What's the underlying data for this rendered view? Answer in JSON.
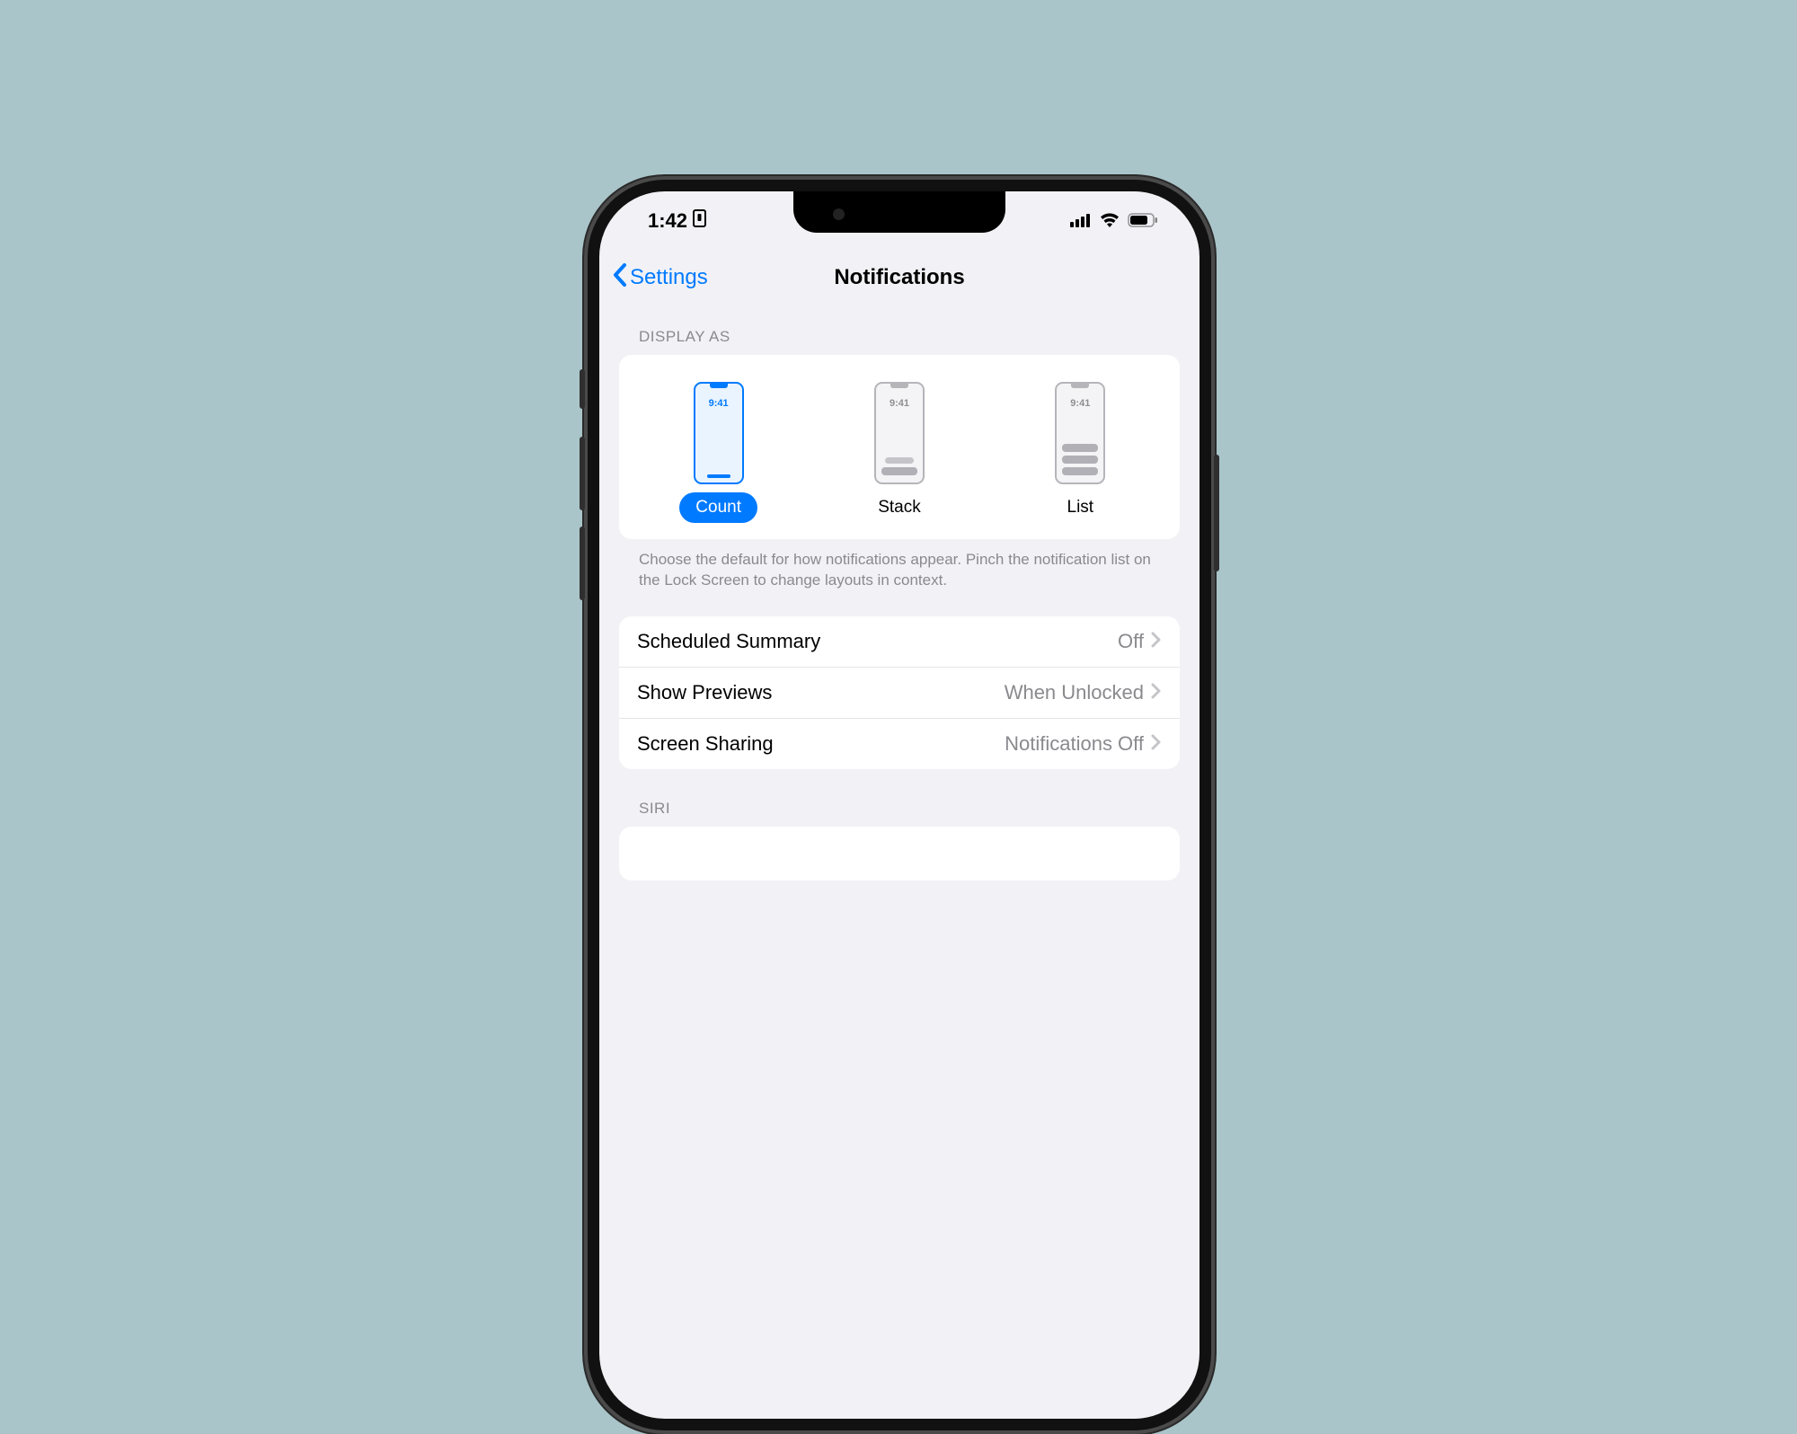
{
  "status": {
    "time": "1:42"
  },
  "nav": {
    "back": "Settings",
    "title": "Notifications"
  },
  "displayAs": {
    "header": "DISPLAY AS",
    "miniTime": "9:41",
    "options": {
      "count": "Count",
      "stack": "Stack",
      "list": "List"
    },
    "footer": "Choose the default for how notifications appear. Pinch the notification list on the Lock Screen to change layouts in context."
  },
  "rows": {
    "scheduled": {
      "label": "Scheduled Summary",
      "value": "Off"
    },
    "previews": {
      "label": "Show Previews",
      "value": "When Unlocked"
    },
    "sharing": {
      "label": "Screen Sharing",
      "value": "Notifications Off"
    }
  },
  "siriHeader": "SIRI"
}
